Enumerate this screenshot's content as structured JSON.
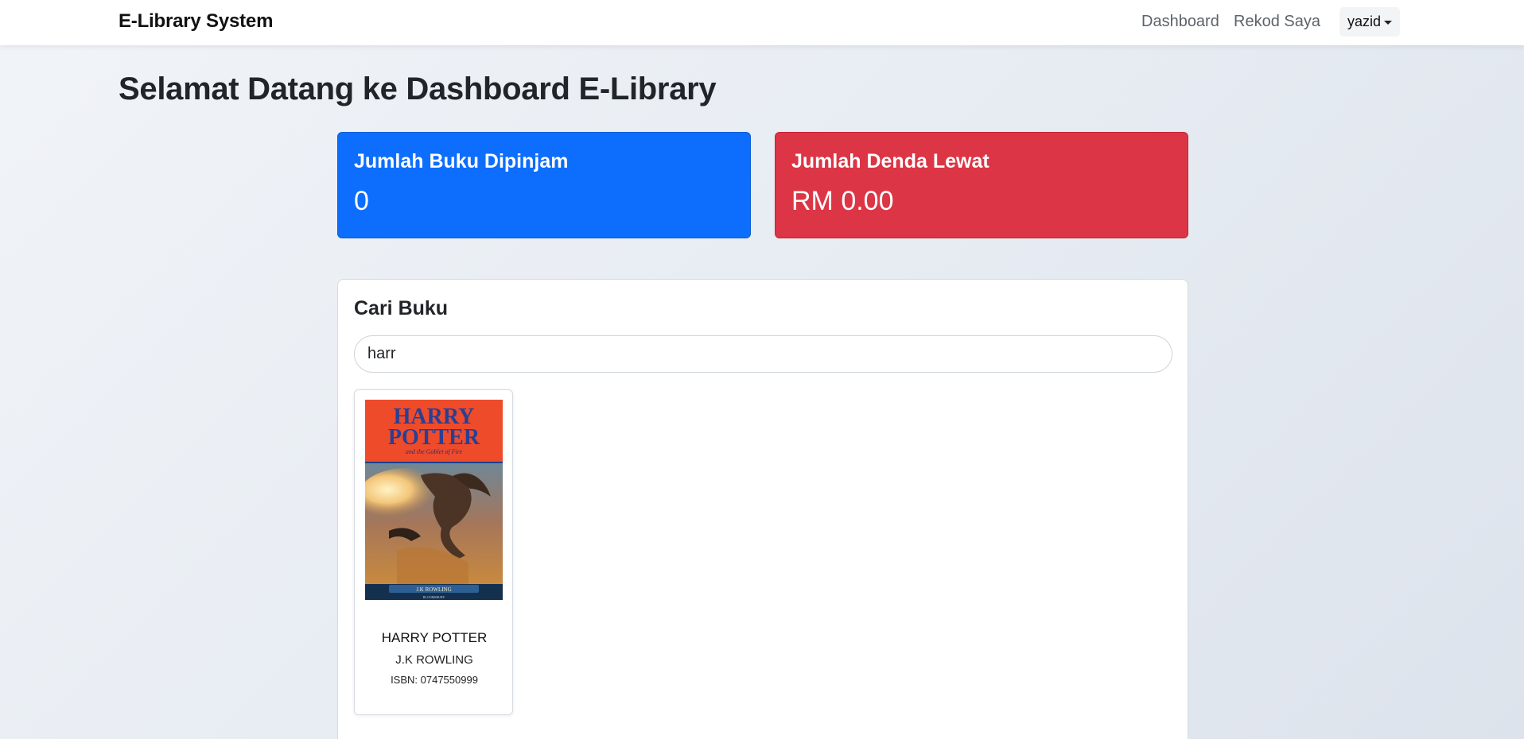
{
  "nav": {
    "brand": "E-Library System",
    "links": [
      "Dashboard",
      "Rekod Saya"
    ],
    "user": "yazid"
  },
  "page_title": "Selamat Datang ke Dashboard E-Library",
  "stats": {
    "borrowed": {
      "title": "Jumlah Buku Dipinjam",
      "value": "0",
      "color": "#0d6efd"
    },
    "fines": {
      "title": "Jumlah Denda Lewat",
      "value": "RM 0.00",
      "color": "#dc3545"
    }
  },
  "search": {
    "title": "Cari Buku",
    "value": "harr",
    "results": [
      {
        "title": "HARRY POTTER",
        "author": "J.K ROWLING",
        "isbn": "ISBN: 0747550999",
        "cover": {
          "title_lines": [
            "HARRY",
            "POTTER"
          ],
          "subtitle": "and the Goblet of Fire",
          "author_band": "J.K ROWLING",
          "publisher": "BLOOMSBURY"
        }
      }
    ]
  }
}
